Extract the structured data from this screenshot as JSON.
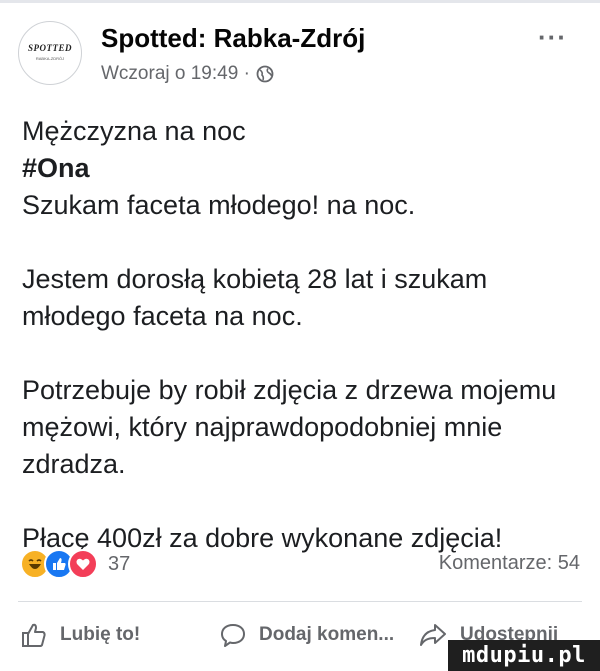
{
  "header": {
    "logo_text": "SPOTTED",
    "logo_sub": "RABKA-ZDRÓJ",
    "author": "Spotted: Rabka-Zdrój",
    "timestamp": "Wczoraj o 19:49 ·",
    "privacy_icon": "globe-icon",
    "more_label": "···"
  },
  "post": {
    "line1": "Mężczyzna na noc",
    "hashtag": "#Ona",
    "line3": "Szukam faceta młodego! na noc.",
    "para2": "Jestem dorosłą kobietą 28 lat i szukam młodego faceta na noc.",
    "para3": "Potrzebuje by robił zdjęcia z drzewa mojemu mężowi, który najprawdopodobniej mnie zdradza.",
    "para4": "Płacę 400zł za dobre wykonane zdjęcia!"
  },
  "reactions": {
    "icons": [
      "haha-icon",
      "like-icon",
      "love-icon"
    ],
    "count": "37",
    "comments": "Komentarze: 54"
  },
  "actions": {
    "like": "Lubię to!",
    "comment": "Dodaj komen...",
    "share": "Udostępnij"
  },
  "watermark": "mdupiu.pl",
  "colors": {
    "text": "#1c1e21",
    "secondary": "#65676b",
    "like_blue": "#1877f2",
    "love_red": "#f33e58",
    "haha_yellow": "#f7b125"
  }
}
